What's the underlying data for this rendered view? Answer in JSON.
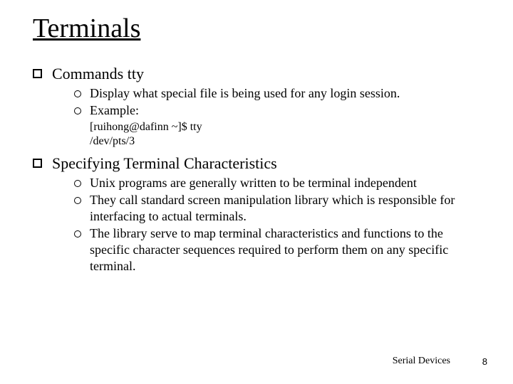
{
  "title": "Terminals",
  "sections": [
    {
      "heading": "Commands tty",
      "items": [
        "Display what special file is being used for any login session.",
        "Example:"
      ],
      "code": [
        "[ruihong@dafinn ~]$ tty",
        "/dev/pts/3"
      ]
    },
    {
      "heading": "Specifying Terminal Characteristics",
      "items": [
        "Unix programs are generally written to be terminal independent",
        "They call standard screen manipulation library which is responsible for interfacing to actual terminals.",
        "The library serve to map terminal characteristics and functions to the specific character sequences required to perform them on any specific terminal."
      ]
    }
  ],
  "footer": {
    "label": "Serial Devices",
    "page": "8"
  }
}
